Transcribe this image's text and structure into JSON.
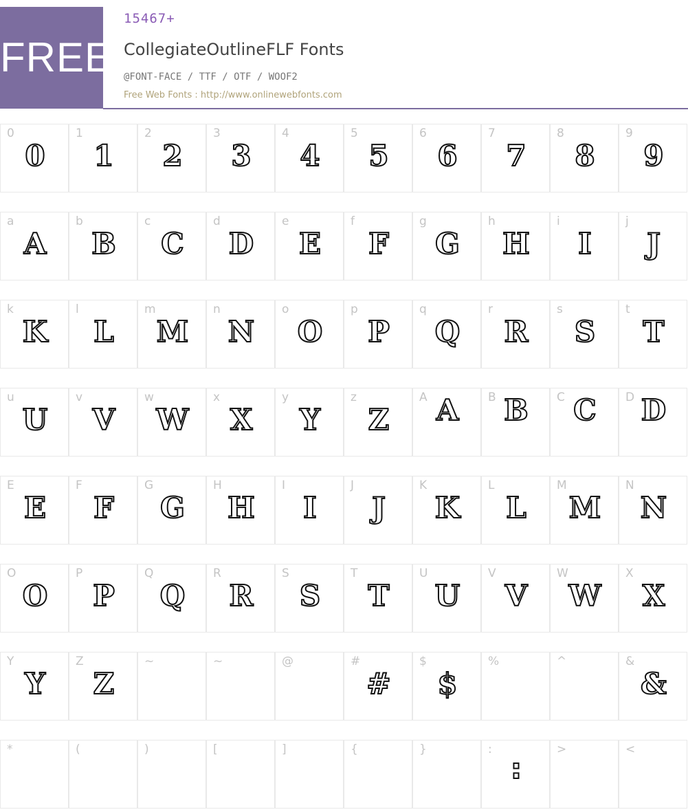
{
  "header": {
    "free_badge": "FREE",
    "count": "15467+",
    "title": "CollegiateOutlineFLF Fonts",
    "formats": "@FONT-FACE / TTF / OTF / WOOF2",
    "site": "Free Web Fonts : http://www.onlinewebfonts.com",
    "brand_color": "#7c6d9f"
  },
  "rows": [
    [
      {
        "label": "0",
        "glyph": "0"
      },
      {
        "label": "1",
        "glyph": "1"
      },
      {
        "label": "2",
        "glyph": "2"
      },
      {
        "label": "3",
        "glyph": "3"
      },
      {
        "label": "4",
        "glyph": "4"
      },
      {
        "label": "5",
        "glyph": "5"
      },
      {
        "label": "6",
        "glyph": "6"
      },
      {
        "label": "7",
        "glyph": "7"
      },
      {
        "label": "8",
        "glyph": "8"
      },
      {
        "label": "9",
        "glyph": "9"
      }
    ],
    [
      {
        "label": "a",
        "glyph": "A"
      },
      {
        "label": "b",
        "glyph": "B"
      },
      {
        "label": "c",
        "glyph": "C"
      },
      {
        "label": "d",
        "glyph": "D"
      },
      {
        "label": "e",
        "glyph": "E"
      },
      {
        "label": "f",
        "glyph": "F"
      },
      {
        "label": "g",
        "glyph": "G"
      },
      {
        "label": "h",
        "glyph": "H"
      },
      {
        "label": "i",
        "glyph": "I"
      },
      {
        "label": "j",
        "glyph": "J"
      }
    ],
    [
      {
        "label": "k",
        "glyph": "K"
      },
      {
        "label": "l",
        "glyph": "L"
      },
      {
        "label": "m",
        "glyph": "M"
      },
      {
        "label": "n",
        "glyph": "N"
      },
      {
        "label": "o",
        "glyph": "O"
      },
      {
        "label": "p",
        "glyph": "P"
      },
      {
        "label": "q",
        "glyph": "Q"
      },
      {
        "label": "r",
        "glyph": "R"
      },
      {
        "label": "s",
        "glyph": "S"
      },
      {
        "label": "t",
        "glyph": "T"
      }
    ],
    [
      {
        "label": "u",
        "glyph": "U"
      },
      {
        "label": "v",
        "glyph": "V"
      },
      {
        "label": "w",
        "glyph": "W"
      },
      {
        "label": "x",
        "glyph": "X"
      },
      {
        "label": "y",
        "glyph": "Y"
      },
      {
        "label": "z",
        "glyph": "Z"
      },
      {
        "label": "A",
        "glyph": "A",
        "up": true
      },
      {
        "label": "B",
        "glyph": "B",
        "up": true
      },
      {
        "label": "C",
        "glyph": "C",
        "up": true
      },
      {
        "label": "D",
        "glyph": "D",
        "up": true
      }
    ],
    [
      {
        "label": "E",
        "glyph": "E"
      },
      {
        "label": "F",
        "glyph": "F"
      },
      {
        "label": "G",
        "glyph": "G"
      },
      {
        "label": "H",
        "glyph": "H"
      },
      {
        "label": "I",
        "glyph": "I"
      },
      {
        "label": "J",
        "glyph": "J"
      },
      {
        "label": "K",
        "glyph": "K"
      },
      {
        "label": "L",
        "glyph": "L"
      },
      {
        "label": "M",
        "glyph": "M"
      },
      {
        "label": "N",
        "glyph": "N"
      }
    ],
    [
      {
        "label": "O",
        "glyph": "O"
      },
      {
        "label": "P",
        "glyph": "P"
      },
      {
        "label": "Q",
        "glyph": "Q"
      },
      {
        "label": "R",
        "glyph": "R"
      },
      {
        "label": "S",
        "glyph": "S"
      },
      {
        "label": "T",
        "glyph": "T"
      },
      {
        "label": "U",
        "glyph": "U"
      },
      {
        "label": "V",
        "glyph": "V"
      },
      {
        "label": "W",
        "glyph": "W"
      },
      {
        "label": "X",
        "glyph": "X"
      }
    ],
    [
      {
        "label": "Y",
        "glyph": "Y"
      },
      {
        "label": "Z",
        "glyph": "Z"
      },
      {
        "label": "~",
        "glyph": ""
      },
      {
        "label": "~",
        "glyph": ""
      },
      {
        "label": "@",
        "glyph": ""
      },
      {
        "label": "#",
        "glyph": "#"
      },
      {
        "label": "$",
        "glyph": "$"
      },
      {
        "label": "%",
        "glyph": ""
      },
      {
        "label": "^",
        "glyph": ""
      },
      {
        "label": "&",
        "glyph": "&"
      }
    ],
    [
      {
        "label": "*",
        "glyph": ""
      },
      {
        "label": "(",
        "glyph": ""
      },
      {
        "label": ")",
        "glyph": ""
      },
      {
        "label": "[",
        "glyph": ""
      },
      {
        "label": "]",
        "glyph": ""
      },
      {
        "label": "{",
        "glyph": ""
      },
      {
        "label": "}",
        "glyph": ""
      },
      {
        "label": ":",
        "glyph": ":",
        "colon": true
      },
      {
        "label": ">",
        "glyph": ""
      },
      {
        "label": "<",
        "glyph": ""
      }
    ]
  ]
}
